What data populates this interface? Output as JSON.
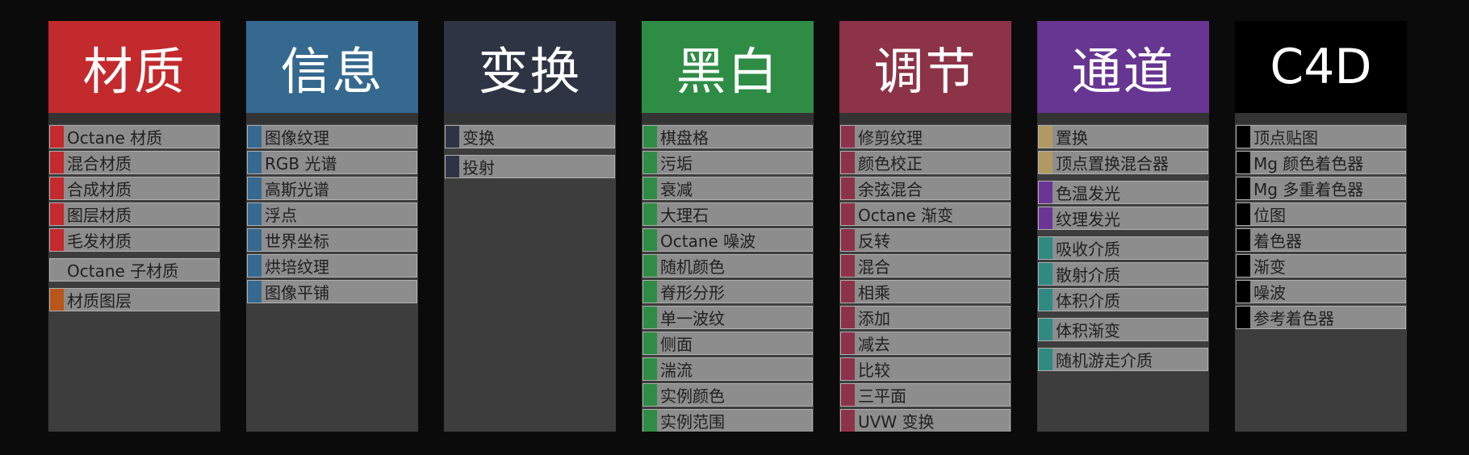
{
  "panels": [
    {
      "title": "材质",
      "color": "#c22a2d",
      "groups": [
        {
          "accent": "#c22a2d",
          "items": [
            "Octane 材质",
            "混合材质",
            "合成材质",
            "图层材质",
            "毛发材质"
          ]
        },
        {
          "accent": "#8d8d8d",
          "items": [
            "Octane 子材质"
          ]
        },
        {
          "accent": "#b8561c",
          "items": [
            "材质图层"
          ]
        }
      ]
    },
    {
      "title": "信息",
      "color": "#35698f",
      "groups": [
        {
          "accent": "#35698f",
          "items": [
            "图像纹理",
            "RGB 光谱",
            "高斯光谱",
            "浮点",
            "世界坐标",
            "烘培纹理",
            "图像平铺"
          ]
        }
      ]
    },
    {
      "title": "变换",
      "color": "#2e3443",
      "groups": [
        {
          "accent": "#2e3443",
          "items": [
            "变换"
          ]
        },
        {
          "accent": "#2e3443",
          "items": [
            "投射"
          ]
        }
      ]
    },
    {
      "title": "黑白",
      "color": "#2f8c45",
      "groups": [
        {
          "accent": "#2f8c45",
          "items": [
            "棋盘格",
            "污垢",
            "衰减",
            "大理石",
            "Octane 噪波",
            "随机颜色",
            "脊形分形",
            "单一波纹",
            "侧面",
            "湍流",
            "实例颜色",
            "实例范围"
          ]
        }
      ]
    },
    {
      "title": "调节",
      "color": "#8c3347",
      "groups": [
        {
          "accent": "#8c3347",
          "items": [
            "修剪纹理",
            "颜色校正",
            "余弦混合",
            "Octane 渐变",
            "反转",
            "混合",
            "相乘",
            "添加",
            "减去",
            "比较",
            "三平面",
            "UVW 变换"
          ]
        }
      ]
    },
    {
      "title": "通道",
      "color": "#673592",
      "groups": [
        {
          "accent": "#b09a62",
          "items": [
            "置换",
            "顶点置换混合器"
          ]
        },
        {
          "accent": "#6b3596",
          "items": [
            "色温发光",
            "纹理发光"
          ]
        },
        {
          "accent": "#2f8a82",
          "items": [
            "吸收介质",
            "散射介质",
            "体积介质"
          ]
        },
        {
          "accent": "#2f8a82",
          "items": [
            "体积渐变"
          ]
        },
        {
          "accent": "#2f8a82",
          "items": [
            "随机游走介质"
          ]
        }
      ]
    },
    {
      "title": "C4D",
      "color": "#000000",
      "groups": [
        {
          "accent": "#000000",
          "items": [
            "顶点贴图",
            "Mg 颜色着色器",
            "Mg 多重着色器",
            "位图",
            "着色器",
            "渐变",
            "噪波",
            "参考着色器"
          ]
        }
      ]
    }
  ]
}
